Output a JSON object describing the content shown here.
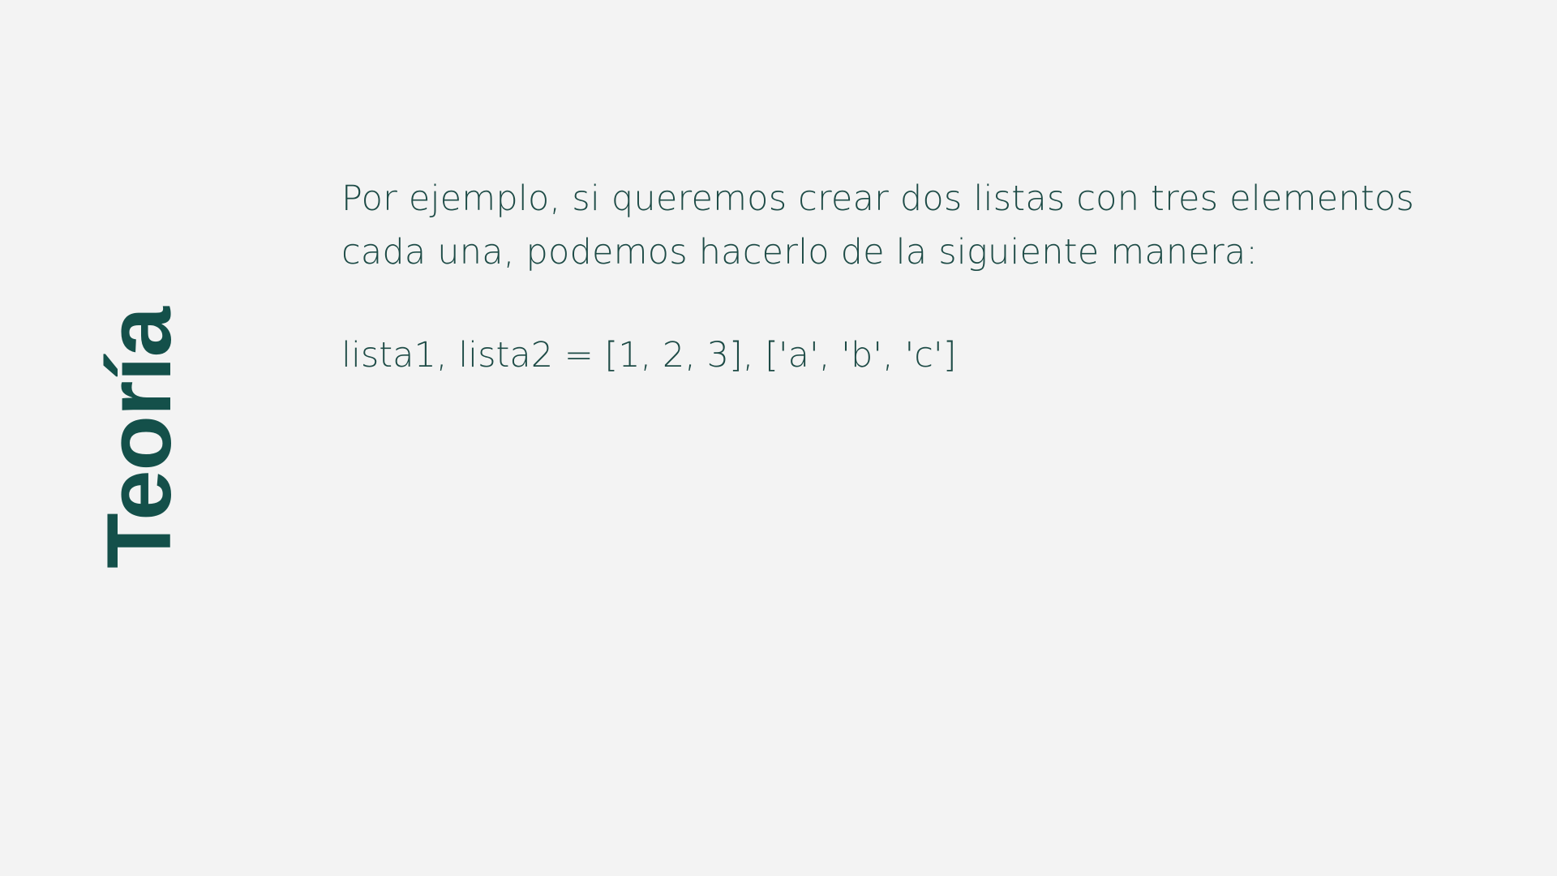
{
  "slide": {
    "side_title": "Teoría",
    "paragraph": "Por ejemplo, si queremos crear dos listas con tres elementos cada una, podemos hacerlo de la siguiente manera:",
    "code": "lista1, lista2 = [1, 2, 3], ['a', 'b', 'c']"
  },
  "colors": {
    "background": "#f3f3f3",
    "title": "#14504a",
    "text": "#1d4b46"
  }
}
